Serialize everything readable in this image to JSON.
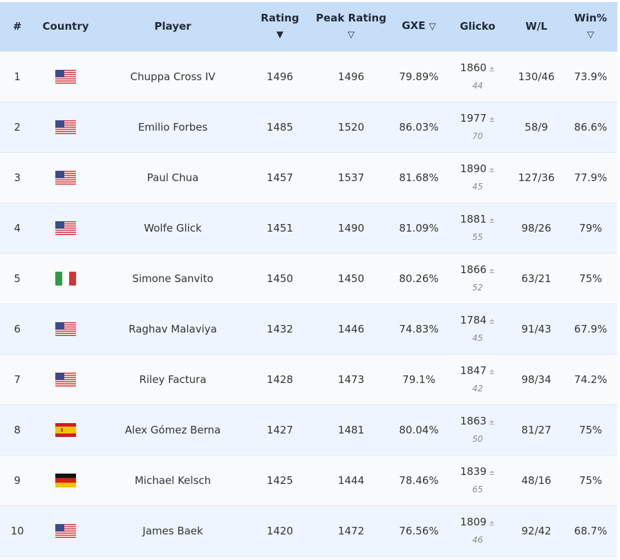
{
  "headers": {
    "rank": "#",
    "country": "Country",
    "player": "Player",
    "rating": "Rating",
    "rating_icon": "▼",
    "peak_rating": "Peak Rating",
    "peak_icon": "▽",
    "gxe": "GXE",
    "gxe_icon": "▽",
    "glicko": "Glicko",
    "wl": "W/L",
    "winpct": "Win%",
    "winpct_icon": "▽"
  },
  "plus_minus": "±",
  "rows": [
    {
      "rank": "1",
      "country": "us-flag-icon",
      "player": "Chuppa Cross IV",
      "rating": "1496",
      "peak": "1496",
      "gxe": "79.89%",
      "glicko": "1860",
      "dev": "44",
      "wl": "130/46",
      "winpct": "73.9%"
    },
    {
      "rank": "2",
      "country": "us-flag-icon",
      "player": "Emilio Forbes",
      "rating": "1485",
      "peak": "1520",
      "gxe": "86.03%",
      "glicko": "1977",
      "dev": "70",
      "wl": "58/9",
      "winpct": "86.6%"
    },
    {
      "rank": "3",
      "country": "us-flag-icon",
      "player": "Paul Chua",
      "rating": "1457",
      "peak": "1537",
      "gxe": "81.68%",
      "glicko": "1890",
      "dev": "45",
      "wl": "127/36",
      "winpct": "77.9%"
    },
    {
      "rank": "4",
      "country": "us-flag-icon",
      "player": "Wolfe Glick",
      "rating": "1451",
      "peak": "1490",
      "gxe": "81.09%",
      "glicko": "1881",
      "dev": "55",
      "wl": "98/26",
      "winpct": "79%"
    },
    {
      "rank": "5",
      "country": "italy-flag-icon",
      "player": "Simone Sanvito",
      "rating": "1450",
      "peak": "1450",
      "gxe": "80.26%",
      "glicko": "1866",
      "dev": "52",
      "wl": "63/21",
      "winpct": "75%"
    },
    {
      "rank": "6",
      "country": "us-flag-icon",
      "player": "Raghav Malaviya",
      "rating": "1432",
      "peak": "1446",
      "gxe": "74.83%",
      "glicko": "1784",
      "dev": "45",
      "wl": "91/43",
      "winpct": "67.9%"
    },
    {
      "rank": "7",
      "country": "us-flag-icon",
      "player": "Riley Factura",
      "rating": "1428",
      "peak": "1473",
      "gxe": "79.1%",
      "glicko": "1847",
      "dev": "42",
      "wl": "98/34",
      "winpct": "74.2%"
    },
    {
      "rank": "8",
      "country": "spain-flag-icon",
      "player": "Alex Gómez Berna",
      "rating": "1427",
      "peak": "1481",
      "gxe": "80.04%",
      "glicko": "1863",
      "dev": "50",
      "wl": "81/27",
      "winpct": "75%"
    },
    {
      "rank": "9",
      "country": "germany-flag-icon",
      "player": "Michael Kelsch",
      "rating": "1425",
      "peak": "1444",
      "gxe": "78.46%",
      "glicko": "1839",
      "dev": "65",
      "wl": "48/16",
      "winpct": "75%"
    },
    {
      "rank": "10",
      "country": "us-flag-icon",
      "player": "James Baek",
      "rating": "1420",
      "peak": "1472",
      "gxe": "76.56%",
      "glicko": "1809",
      "dev": "46",
      "wl": "92/42",
      "winpct": "68.7%"
    }
  ]
}
